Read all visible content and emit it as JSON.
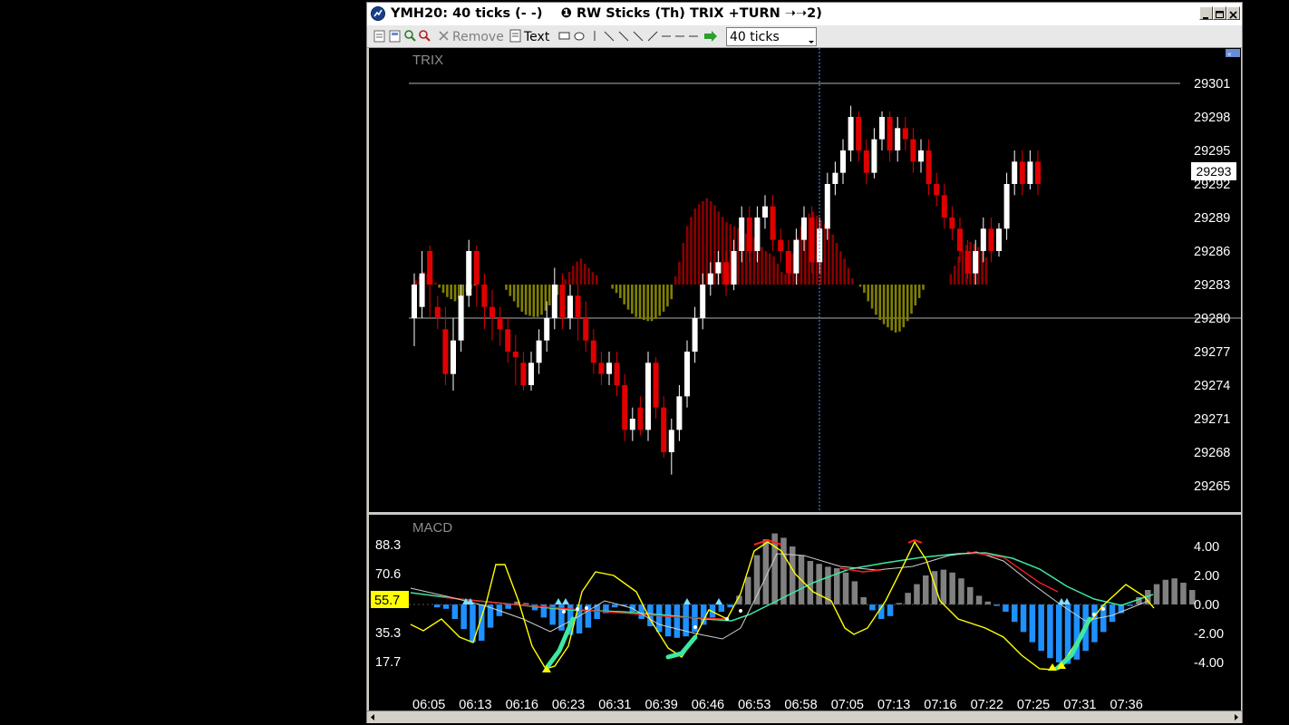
{
  "window": {
    "title": "YMH20: 40 ticks (- -)    ❶ RW Sticks (Th) TRIX +TURN ➝➝2)"
  },
  "toolbar": {
    "remove_label": "Remove",
    "text_label": "Text",
    "interval_value": "40 ticks"
  },
  "price_panel": {
    "indicator_label": "TRIX",
    "y_ticks": [
      "29301",
      "29298",
      "29295",
      "29292",
      "29289",
      "29286",
      "29283",
      "29280",
      "29277",
      "29274",
      "29271",
      "29268",
      "29265"
    ],
    "current_price": "29293"
  },
  "macd_panel": {
    "indicator_label": "MACD",
    "left_ticks": [
      "88.3",
      "70.6",
      "55.7",
      "35.3",
      "17.7"
    ],
    "left_highlight": "55.7",
    "right_ticks": [
      "4.00",
      "2.00",
      "0.00",
      "-2.00",
      "-4.00"
    ]
  },
  "time_axis": [
    "06:05",
    "06:13",
    "06:16",
    "06:23",
    "06:31",
    "06:39",
    "06:46",
    "06:53",
    "06:58",
    "07:05",
    "07:13",
    "07:16",
    "07:22",
    "07:25",
    "07:31",
    "07:36"
  ],
  "colors": {
    "up_candle": "#ffffff",
    "down_candle": "#e00000",
    "trix_positive": "#8b0000",
    "trix_negative": "#808000",
    "macd_histogram_negative": "#1e90ff",
    "macd_histogram_positive": "#808080",
    "stochastic_line": "#ffff00",
    "signal_up": "#3ee8a0",
    "signal_down": "#ff2020",
    "highlight_box": "#ffff00"
  }
}
